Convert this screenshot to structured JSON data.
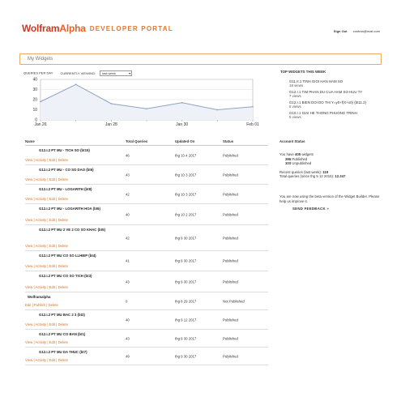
{
  "header": {
    "logo_wolfram": "Wolfram",
    "logo_alpha": "Alpha",
    "logo_portal": "DEVELOPER PORTAL",
    "signout": "Sign Out",
    "email": "contran@mail.com"
  },
  "mywidgets_title": "My Widgets",
  "chart_controls": {
    "queries_label": "QUERIES PER DAY",
    "viewing_label": "CURRENTLY VIEWING:",
    "viewing_value": "last week"
  },
  "chart_data": {
    "type": "line",
    "x": [
      "Jan 26",
      "Jan 27",
      "Jan 28",
      "Jan 29",
      "Jan 30",
      "Jan 31",
      "Feb 01"
    ],
    "values": [
      18,
      35,
      16,
      11,
      17,
      10,
      13
    ],
    "tick_labels": [
      "Jan 26",
      "Jan 28",
      "Jan 30",
      "Feb 01"
    ],
    "y_ticks": [
      "0",
      "10",
      "20",
      "30",
      "40"
    ],
    "ylim": [
      0,
      40
    ],
    "grid": true,
    "color": "#8fa3c2"
  },
  "top_widgets": {
    "title": "TOP WIDGETS THIS WEEK",
    "items": [
      {
        "name": "G11.II.1 TINH GIOI HAN HAM SO",
        "views": "18 views"
      },
      {
        "name": "G12.I.1 TIM PHAN DU CUA HAM SO HUU TY",
        "views": "7 views"
      },
      {
        "name": "G12.I.1 BIEN DOI DO THI Y=y0+f(X+x0) (bt11.2)",
        "views": "6 views"
      },
      {
        "name": "G10.I.1 GIAI HE THONG PHUONG TRINH",
        "views": "5 views"
      }
    ]
  },
  "table": {
    "headers": [
      "Name",
      "Total Queries",
      "Updated On",
      "Status"
    ],
    "rows": [
      {
        "name": "G12.I.2 PT MU - TICH SO (bt15)",
        "links": [
          "View",
          "Activity",
          "Edit",
          "Delete"
        ],
        "queries": "46",
        "updated": "thg 10 4 2017",
        "status": "Published"
      },
      {
        "name": "G12.I.2 PT MU - CO SO DAO (bt6)",
        "links": [
          "View",
          "Activity",
          "Edit",
          "Delete"
        ],
        "queries": "43",
        "updated": "thg 10 3 2017",
        "status": "Published"
      },
      {
        "name": "G12.I.2 PT MU - LOGARITH (bt8)",
        "links": [
          "View",
          "Activity",
          "Edit",
          "Delete"
        ],
        "queries": "42",
        "updated": "thg 10 3 2017",
        "status": "Published"
      },
      {
        "name": "G12.I.2 PT MU - LOGARITH HOA (bt6)",
        "links": [
          "View",
          "Activity",
          "Edit",
          "Delete"
        ],
        "queries": "40",
        "updated": "thg 10 2 2017",
        "status": "Published"
      },
      {
        "name": "G12.I.2 PT MU 2 VE 2 CO SO KHAC (bt5)",
        "links": [
          "View",
          "Activity",
          "Edit",
          "Delete"
        ],
        "queries": "42",
        "updated": "thg 9 30 2017",
        "status": "Published"
      },
      {
        "name": "G12.I.2 PT MU CO SO LLHIEP (bt4)",
        "links": [
          "View",
          "Activity",
          "Edit",
          "Delete"
        ],
        "queries": "41",
        "updated": "thg 9 30 2017",
        "status": "Published"
      },
      {
        "name": "G12.I.2 PT MU CO SO TICH (bt3)",
        "links": [
          "View",
          "Activity",
          "Edit",
          "Delete"
        ],
        "queries": "43",
        "updated": "thg 9 30 2017",
        "status": "Published"
      },
      {
        "name": "Wolframalpha",
        "links": [
          "Edit",
          "Publish",
          "Delete"
        ],
        "queries": "0",
        "updated": "thg 8 29 2017",
        "status": "Not Published"
      },
      {
        "name": "G12.I.2 PT MU BAC 2 3 (bt2)",
        "links": [
          "View",
          "Activity",
          "Edit",
          "Delete"
        ],
        "queries": "40",
        "updated": "thg 9 12 2017",
        "status": "Published"
      },
      {
        "name": "G12.I.2 PT MU CO BAN (bt1)",
        "links": [
          "View",
          "Activity",
          "Edit",
          "Delete"
        ],
        "queries": "43",
        "updated": "thg 9 30 2017",
        "status": "Published"
      },
      {
        "name": "G12.I.2 PT MU DA THUC (bt7)",
        "links": [
          "View",
          "Activity",
          "Edit",
          "Delete"
        ],
        "queries": "49",
        "updated": "thg 9 30 2017",
        "status": "Published"
      }
    ]
  },
  "account": {
    "title": "Account Status",
    "widgets_prefix": "You have ",
    "widgets_count": "405",
    "widgets_suffix": " widgets",
    "published_count": "396",
    "published_label": " Published",
    "unpublished_count": "103",
    "unpublished_label": " Unpublished",
    "recent_label": "Recent queries (last week): ",
    "recent_value": "119",
    "total_label": "Total queries (since thg 5 12 2015): ",
    "total_value": "12.347",
    "beta_text": "You are now using the beta version of the Widget Builder. Please help us improve it.",
    "feedback": "SEND FEEDBACK »"
  }
}
